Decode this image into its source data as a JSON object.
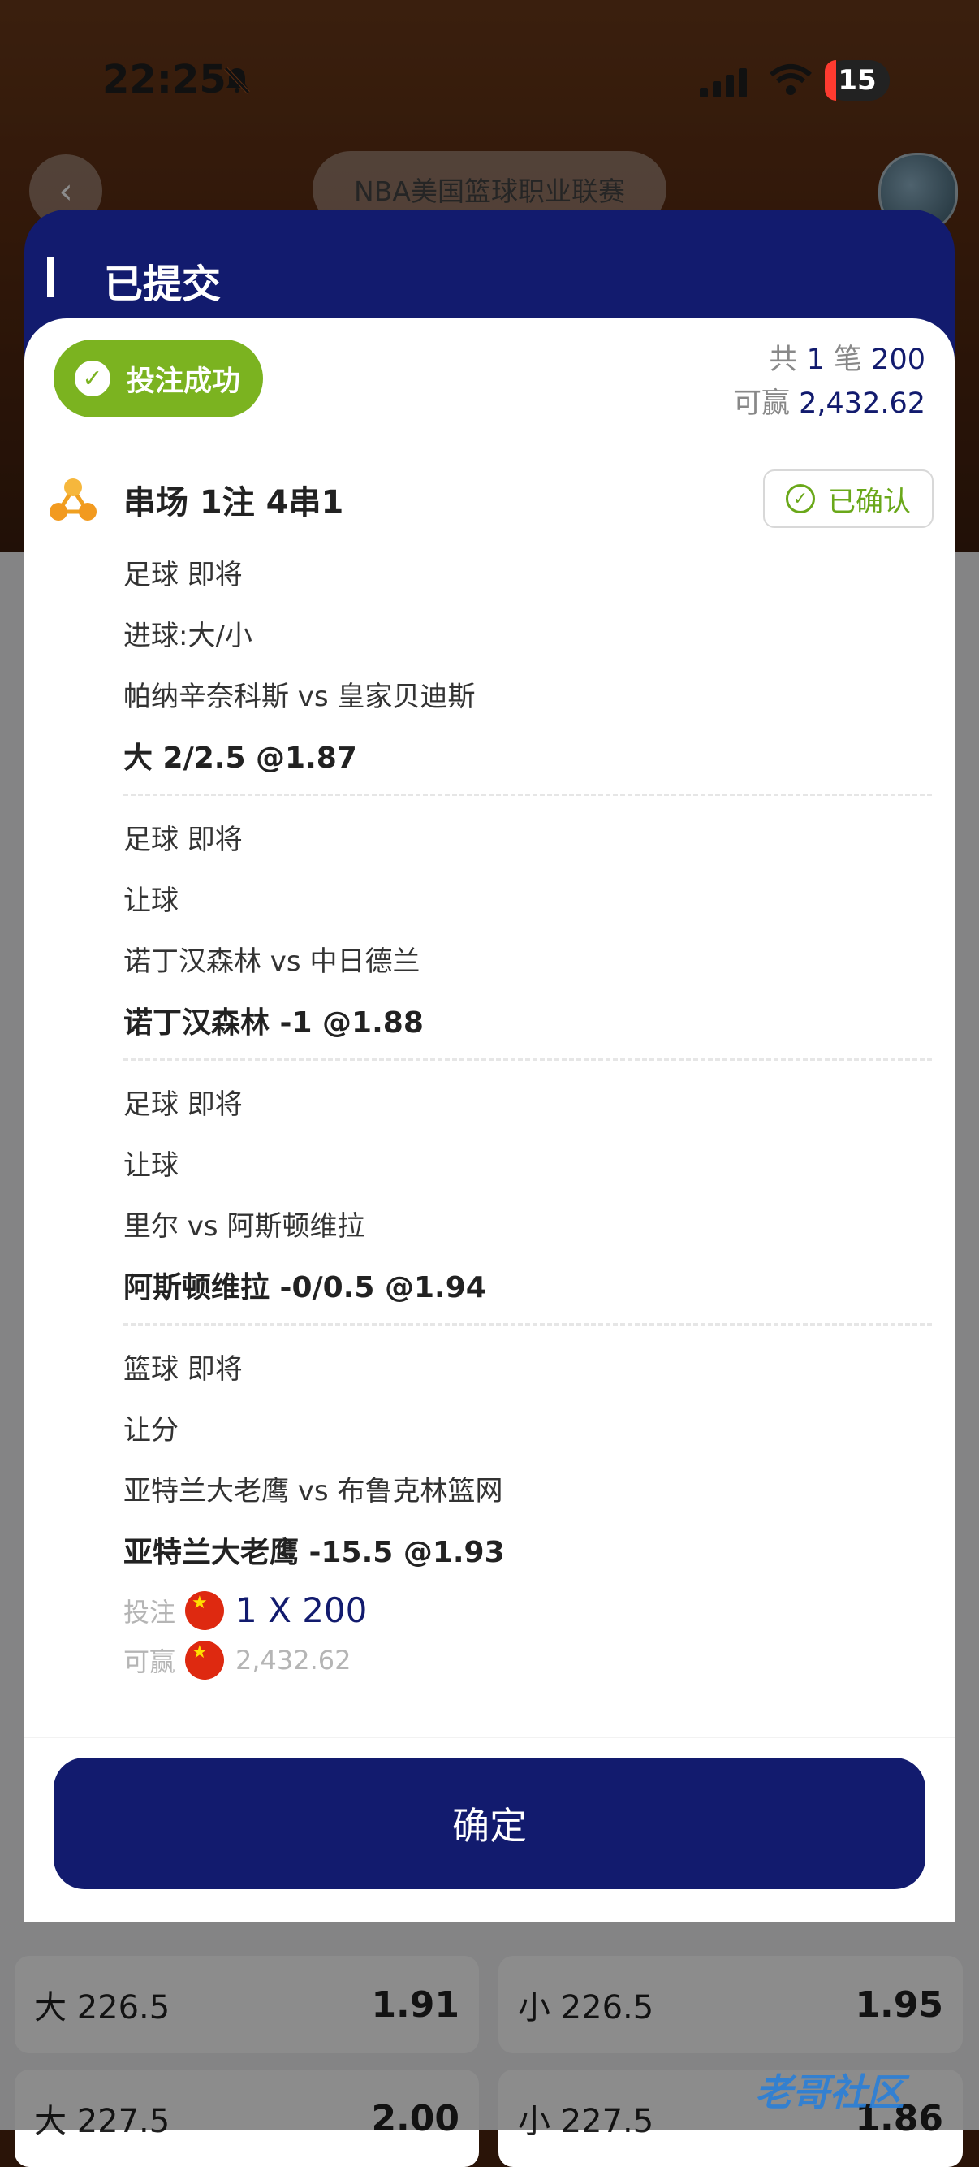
{
  "status_bar": {
    "time": "22:25",
    "battery": "15"
  },
  "header": {
    "league": "NBA美国篮球职业联赛"
  },
  "background_odds": [
    {
      "label": "大 226.5",
      "odds": "1.91"
    },
    {
      "label": "小 226.5",
      "odds": "1.95"
    },
    {
      "label": "大 227.5",
      "odds": "2.00"
    },
    {
      "label": "小 227.5",
      "odds": "1.86"
    }
  ],
  "modal": {
    "title": "已提交",
    "success_label": "投注成功",
    "summary": {
      "count_prefix": "共",
      "count": "1",
      "count_unit": "笔",
      "amount": "200",
      "win_label": "可赢",
      "win_amount": "2,432.62"
    },
    "parlay": {
      "title": "串场 1注 4串1",
      "status": "已确认",
      "legs": [
        {
          "sport_status": "足球 即将",
          "market": "进球:大/小",
          "match": "帕纳辛奈科斯 vs 皇家贝迪斯",
          "pick": "大 2/2.5 @1.87"
        },
        {
          "sport_status": "足球 即将",
          "market": "让球",
          "match": "诺丁汉森林 vs 中日德兰",
          "pick": "诺丁汉森林 -1 @1.88"
        },
        {
          "sport_status": "足球 即将",
          "market": "让球",
          "match": "里尔 vs 阿斯顿维拉",
          "pick": "阿斯顿维拉 -0/0.5 @1.94"
        },
        {
          "sport_status": "篮球 即将",
          "market": "让分",
          "match": "亚特兰大老鹰 vs 布鲁克林篮网",
          "pick": "亚特兰大老鹰 -15.5 @1.93"
        }
      ],
      "stake_label": "投注",
      "stake_value": "1 X 200",
      "win_label": "可赢",
      "win_value": "2,432.62"
    },
    "confirm_button": "确定"
  },
  "watermark": "老哥社区",
  "colors": {
    "navy": "#121b6e",
    "success_green": "#7bb320",
    "confirmed_green": "#6aa81a"
  }
}
